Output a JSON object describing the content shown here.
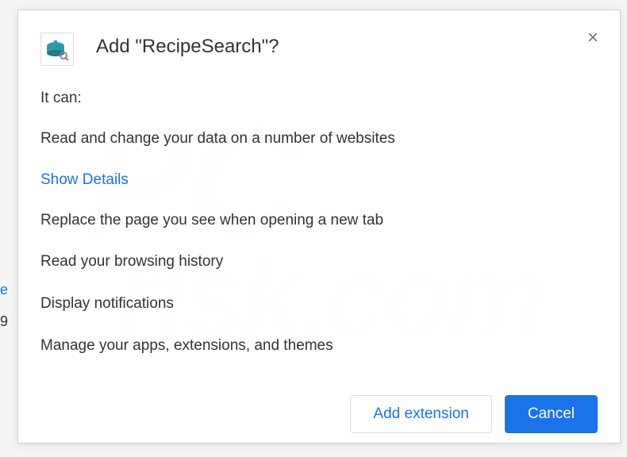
{
  "dialog": {
    "title": "Add \"RecipeSearch\"?",
    "intro": "It can:",
    "permissions": [
      "Read and change your data on a number of websites",
      "Replace the page you see when opening a new tab",
      "Read your browsing history",
      "Display notifications",
      "Manage your apps, extensions, and themes"
    ],
    "show_details": "Show Details"
  },
  "buttons": {
    "add": "Add extension",
    "cancel": "Cancel"
  },
  "watermark": {
    "line1": "PC",
    "line2": "risk.com"
  },
  "background": {
    "edge1": "e",
    "edge2": "9"
  }
}
